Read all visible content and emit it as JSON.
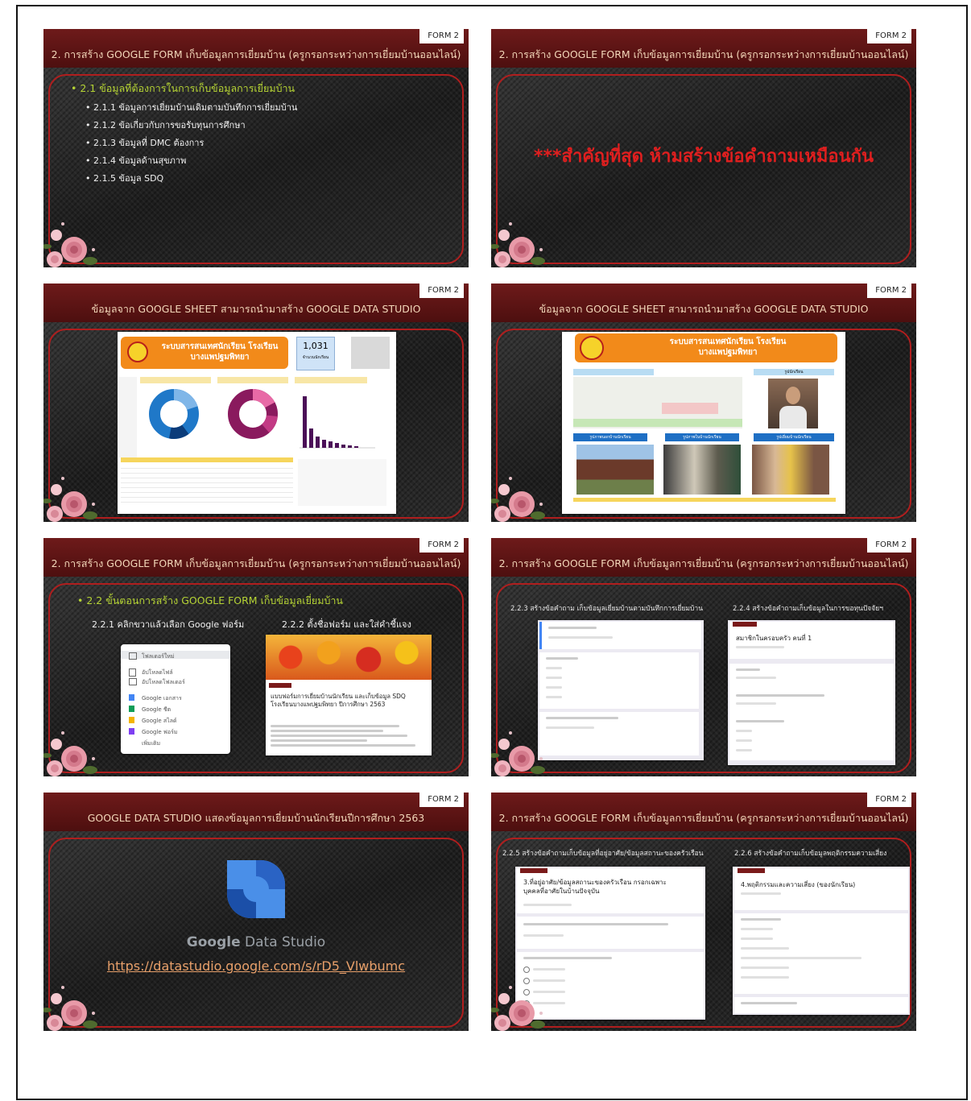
{
  "slides": {
    "s1": {
      "tag": "FORM 2",
      "title": "2. การสร้าง  GOOGLE FORM เก็บข้อมูลการเยี่ยมบ้าน (ครูกรอกระหว่างการเยี่ยมบ้านออนไลน์)",
      "heading": "2.1 ข้อมูลที่ต้องการในการเก็บข้อมูลการเยี่ยมบ้าน",
      "items": [
        "2.1.1 ข้อมูลการเยี่ยมบ้านเดิมตามบันทึกการเยี่ยมบ้าน",
        "2.1.2 ข้อเกี่ยวกับการขอรับทุนการศึกษา",
        "2.1.3 ข้อมูลที่ DMC ต้องการ",
        "2.1.4 ข้อมูลด้านสุขภาพ",
        "2.1.5 ข้อมูล SDQ"
      ]
    },
    "s2": {
      "tag": "FORM 2",
      "title": "2. การสร้าง  GOOGLE FORM เก็บข้อมูลการเยี่ยมบ้าน (ครูกรอกระหว่างการเยี่ยมบ้านออนไลน์)",
      "warning": "***สำคัญที่สุด ห้ามสร้างข้อคำถามเหมือนกัน"
    },
    "s3": {
      "tag": "FORM 2",
      "title": "ข้อมูลจาก GOOGLE SHEET สามารถนำมาสร้าง GOOGLE DATA STUDIO",
      "banner": "ระบบสารสนเทศนักเรียน โรงเรียนบางแพปฐมพิทยา",
      "kpi_value": "1,031",
      "kpi_label": "จำนวนนักเรียน"
    },
    "s4": {
      "tag": "FORM 2",
      "title": "ข้อมูลจาก GOOGLE SHEET สามารถนำมาสร้าง GOOGLE DATA STUDIO",
      "banner": "ระบบสารสนเทศนักเรียน โรงเรียนบางแพปฐมพิทยา",
      "photo_label": "รูปนักเรียน",
      "btn1": "รูปภาพนอกบ้านนักเรียน",
      "btn2": "รูปภาพในบ้านนักเรียน",
      "btn3": "รูปเยี่ยมบ้านนักเรียน"
    },
    "s5": {
      "tag": "FORM 2",
      "title": "2. การสร้าง  GOOGLE FORM เก็บข้อมูลการเยี่ยมบ้าน (ครูกรอกระหว่างการเยี่ยมบ้านออนไลน์)",
      "heading": "2.2 ขั้นตอนการสร้าง GOOGLE FORM เก็บข้อมูลเยี่ยมบ้าน",
      "step1": "2.2.1  คลิกขวาแล้วเลือก Google ฟอร์ม",
      "step2": "2.2.2  ตั้งชื่อฟอร์ม และใส่คำชี้แจง",
      "menu": [
        "โฟลเดอร์ใหม่",
        "อัปโหลดไฟล์",
        "อัปโหลดโฟลเดอร์",
        "Google เอกสาร",
        "Google ชีต",
        "Google สไลด์",
        "Google ฟอร์ม",
        "เพิ่มเติม"
      ],
      "form_title": "แบบฟอร์มการเยี่ยมบ้านนักเรียน และเก็บข้อมูล SDQ โรงเรียนบางแพปฐมพิทยา ปีการศึกษา 2563"
    },
    "s6": {
      "tag": "FORM 2",
      "title": "2. การสร้าง  GOOGLE FORM เก็บข้อมูลการเยี่ยมบ้าน (ครูกรอกระหว่างการเยี่ยมบ้านออนไลน์)",
      "step1": "2.2.3  สร้างข้อคำถาม เก็บข้อมูลเยี่ยมบ้านตามบันทึกการเยี่ยมบ้าน",
      "step2": "2.2.4 สร้างข้อคำถามเก็บข้อมูลในการขอทุนปัจจัยฯ",
      "card_title": "สมาชิกในครอบครัว คนที่ 1"
    },
    "s7": {
      "tag": "FORM 2",
      "title": "GOOGLE DATA STUDIO แสดงข้อมูลการเยี่ยมบ้านนักเรียนปีการศึกษา 2563",
      "logo_google": "Google",
      "logo_product": "Data Studio",
      "link": "https://datastudio.google.com/s/rD5_Vlwbumc"
    },
    "s8": {
      "tag": "FORM 2",
      "title": "2. การสร้าง  GOOGLE FORM เก็บข้อมูลการเยี่ยมบ้าน (ครูกรอกระหว่างการเยี่ยมบ้านออนไลน์)",
      "step1": "2.2.5 สร้างข้อคำถามเก็บข้อมูลที่อยู่อาศัย/ข้อมูลสถานะของครัวเรือน",
      "step2": "2.2.6  สร้างข้อคำถามเก็บข้อมูลพฤติกรรมความเสี่ยง",
      "card1_title": "3.ที่อยู่อาศัย/ข้อมูลสถานะของครัวเรือน กรอกเฉพาะบุคคลที่อาศัยในบ้านปัจจุบัน",
      "card2_title": "4.พฤติกรรมและความเสี่ยง (ของนักเรียน)"
    }
  },
  "colors": {
    "header": "#5b1414",
    "panel_border": "#b01e1e",
    "bullet_heading": "#b5d334",
    "warning": "#e01f1f",
    "link": "#e8a06a"
  }
}
